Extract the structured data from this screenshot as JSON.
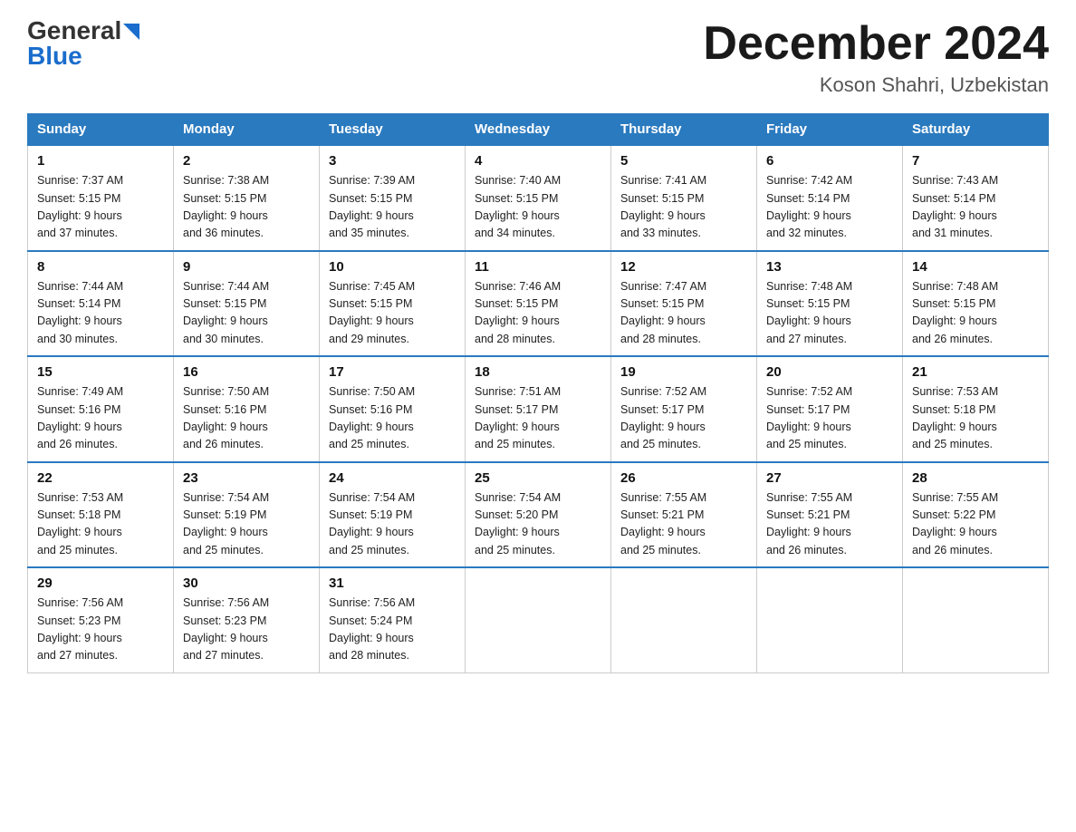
{
  "logo": {
    "general": "General",
    "blue": "Blue"
  },
  "title": "December 2024",
  "location": "Koson Shahri, Uzbekistan",
  "weekdays": [
    "Sunday",
    "Monday",
    "Tuesday",
    "Wednesday",
    "Thursday",
    "Friday",
    "Saturday"
  ],
  "weeks": [
    [
      {
        "day": "1",
        "sunrise": "7:37 AM",
        "sunset": "5:15 PM",
        "daylight": "9 hours and 37 minutes."
      },
      {
        "day": "2",
        "sunrise": "7:38 AM",
        "sunset": "5:15 PM",
        "daylight": "9 hours and 36 minutes."
      },
      {
        "day": "3",
        "sunrise": "7:39 AM",
        "sunset": "5:15 PM",
        "daylight": "9 hours and 35 minutes."
      },
      {
        "day": "4",
        "sunrise": "7:40 AM",
        "sunset": "5:15 PM",
        "daylight": "9 hours and 34 minutes."
      },
      {
        "day": "5",
        "sunrise": "7:41 AM",
        "sunset": "5:15 PM",
        "daylight": "9 hours and 33 minutes."
      },
      {
        "day": "6",
        "sunrise": "7:42 AM",
        "sunset": "5:14 PM",
        "daylight": "9 hours and 32 minutes."
      },
      {
        "day": "7",
        "sunrise": "7:43 AM",
        "sunset": "5:14 PM",
        "daylight": "9 hours and 31 minutes."
      }
    ],
    [
      {
        "day": "8",
        "sunrise": "7:44 AM",
        "sunset": "5:14 PM",
        "daylight": "9 hours and 30 minutes."
      },
      {
        "day": "9",
        "sunrise": "7:44 AM",
        "sunset": "5:15 PM",
        "daylight": "9 hours and 30 minutes."
      },
      {
        "day": "10",
        "sunrise": "7:45 AM",
        "sunset": "5:15 PM",
        "daylight": "9 hours and 29 minutes."
      },
      {
        "day": "11",
        "sunrise": "7:46 AM",
        "sunset": "5:15 PM",
        "daylight": "9 hours and 28 minutes."
      },
      {
        "day": "12",
        "sunrise": "7:47 AM",
        "sunset": "5:15 PM",
        "daylight": "9 hours and 28 minutes."
      },
      {
        "day": "13",
        "sunrise": "7:48 AM",
        "sunset": "5:15 PM",
        "daylight": "9 hours and 27 minutes."
      },
      {
        "day": "14",
        "sunrise": "7:48 AM",
        "sunset": "5:15 PM",
        "daylight": "9 hours and 26 minutes."
      }
    ],
    [
      {
        "day": "15",
        "sunrise": "7:49 AM",
        "sunset": "5:16 PM",
        "daylight": "9 hours and 26 minutes."
      },
      {
        "day": "16",
        "sunrise": "7:50 AM",
        "sunset": "5:16 PM",
        "daylight": "9 hours and 26 minutes."
      },
      {
        "day": "17",
        "sunrise": "7:50 AM",
        "sunset": "5:16 PM",
        "daylight": "9 hours and 25 minutes."
      },
      {
        "day": "18",
        "sunrise": "7:51 AM",
        "sunset": "5:17 PM",
        "daylight": "9 hours and 25 minutes."
      },
      {
        "day": "19",
        "sunrise": "7:52 AM",
        "sunset": "5:17 PM",
        "daylight": "9 hours and 25 minutes."
      },
      {
        "day": "20",
        "sunrise": "7:52 AM",
        "sunset": "5:17 PM",
        "daylight": "9 hours and 25 minutes."
      },
      {
        "day": "21",
        "sunrise": "7:53 AM",
        "sunset": "5:18 PM",
        "daylight": "9 hours and 25 minutes."
      }
    ],
    [
      {
        "day": "22",
        "sunrise": "7:53 AM",
        "sunset": "5:18 PM",
        "daylight": "9 hours and 25 minutes."
      },
      {
        "day": "23",
        "sunrise": "7:54 AM",
        "sunset": "5:19 PM",
        "daylight": "9 hours and 25 minutes."
      },
      {
        "day": "24",
        "sunrise": "7:54 AM",
        "sunset": "5:19 PM",
        "daylight": "9 hours and 25 minutes."
      },
      {
        "day": "25",
        "sunrise": "7:54 AM",
        "sunset": "5:20 PM",
        "daylight": "9 hours and 25 minutes."
      },
      {
        "day": "26",
        "sunrise": "7:55 AM",
        "sunset": "5:21 PM",
        "daylight": "9 hours and 25 minutes."
      },
      {
        "day": "27",
        "sunrise": "7:55 AM",
        "sunset": "5:21 PM",
        "daylight": "9 hours and 26 minutes."
      },
      {
        "day": "28",
        "sunrise": "7:55 AM",
        "sunset": "5:22 PM",
        "daylight": "9 hours and 26 minutes."
      }
    ],
    [
      {
        "day": "29",
        "sunrise": "7:56 AM",
        "sunset": "5:23 PM",
        "daylight": "9 hours and 27 minutes."
      },
      {
        "day": "30",
        "sunrise": "7:56 AM",
        "sunset": "5:23 PM",
        "daylight": "9 hours and 27 minutes."
      },
      {
        "day": "31",
        "sunrise": "7:56 AM",
        "sunset": "5:24 PM",
        "daylight": "9 hours and 28 minutes."
      },
      null,
      null,
      null,
      null
    ]
  ],
  "labels": {
    "sunrise": "Sunrise:",
    "sunset": "Sunset:",
    "daylight": "Daylight:"
  }
}
